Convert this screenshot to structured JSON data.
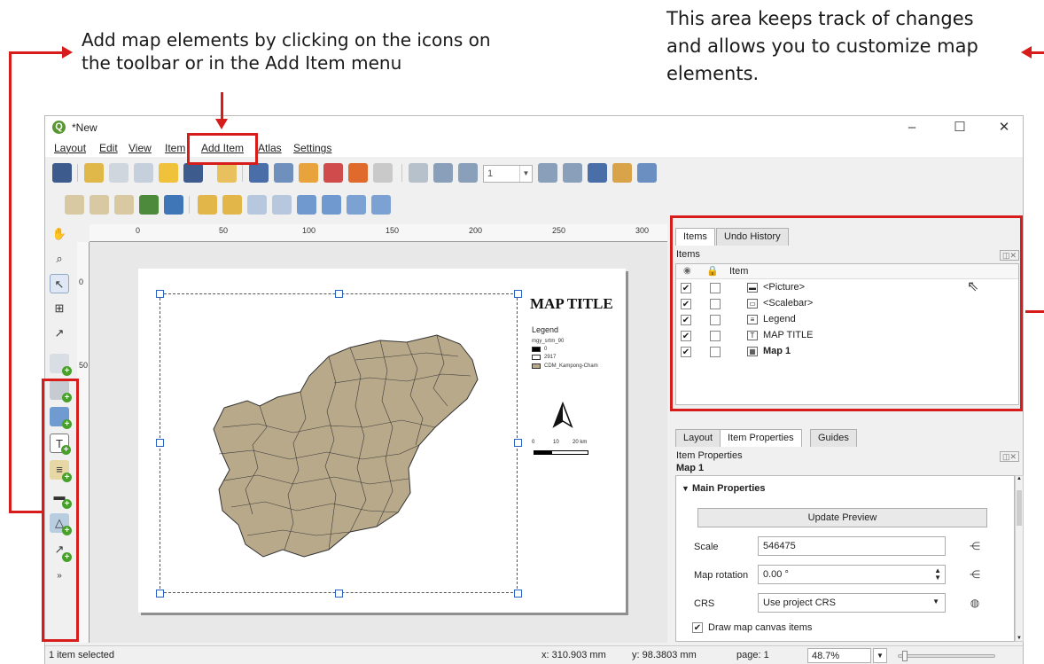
{
  "annotations": {
    "left_line1": "Add map elements by clicking on the icons on",
    "left_line2": "the toolbar or in the Add Item menu",
    "right_line1": "This area keeps track of changes",
    "right_line2": "and allows you to customize map",
    "right_line3": "elements.",
    "highlight_color": "#d71c1c"
  },
  "window": {
    "title": "*New",
    "minimize": "–",
    "maximize": "☐",
    "close": "✕"
  },
  "menu": {
    "items": [
      "Layout",
      "Edit",
      "View",
      "Item",
      "Add Item",
      "Atlas",
      "Settings"
    ]
  },
  "toolbar": {
    "page_value": "1"
  },
  "ruler": {
    "top_ticks": [
      "0",
      "50",
      "100",
      "150",
      "200",
      "250",
      "300"
    ],
    "left_ticks": [
      "0",
      "50"
    ]
  },
  "layout_canvas": {
    "map_title": "MAP TITLE",
    "legend_title": "Legend",
    "legend_layer": "mgy_srtm_90",
    "legend_min": "0",
    "legend_max": "2917",
    "legend_polygon": "CDM_Kampong-Cham",
    "scale_labels": [
      "0",
      "10",
      "20 km"
    ],
    "map_fill_color": "#b8a98a"
  },
  "items_panel": {
    "tabs": [
      "Items",
      "Undo History"
    ],
    "subtitle": "Items",
    "column_item": "Item",
    "rows": [
      {
        "name": "<Picture>",
        "visible": "✔",
        "icon": "▬"
      },
      {
        "name": "<Scalebar>",
        "visible": "✔",
        "icon": "▭"
      },
      {
        "name": "Legend",
        "visible": "✔",
        "icon": "≡"
      },
      {
        "name": "MAP TITLE",
        "visible": "✔",
        "icon": "T"
      },
      {
        "name": "Map 1",
        "visible": "✔",
        "icon": "▦"
      }
    ]
  },
  "props_panel": {
    "tabs": [
      "Layout",
      "Item Properties",
      "Guides"
    ],
    "subtitle": "Item Properties",
    "item_name": "Map 1",
    "section": "Main Properties",
    "update_button": "Update Preview",
    "scale_label": "Scale",
    "scale_value": "546475",
    "rotation_label": "Map rotation",
    "rotation_value": "0.00 °",
    "crs_label": "CRS",
    "crs_value": "Use project CRS",
    "draw_items_label": "Draw map canvas items"
  },
  "status": {
    "selection": "1 item selected",
    "x": "x: 310.903 mm",
    "y": "y: 98.3803 mm",
    "page": "page: 1",
    "zoom": "48.7%"
  }
}
